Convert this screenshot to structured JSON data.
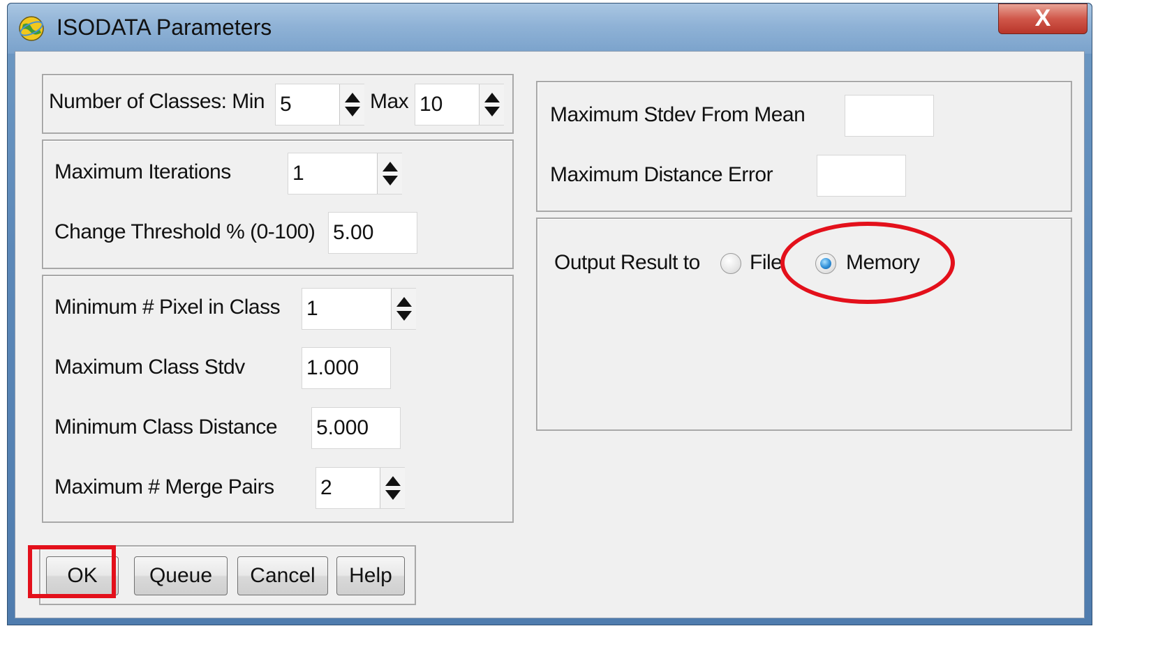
{
  "window": {
    "title": "ISODATA Parameters",
    "close_label": "X"
  },
  "classes": {
    "label": "Number of Classes: Min",
    "min_value": "5",
    "max_label": "Max",
    "max_value": "10"
  },
  "iterations": {
    "label": "Maximum Iterations",
    "value": "1"
  },
  "threshold": {
    "label": "Change Threshold % (0-100)",
    "value": "5.00"
  },
  "min_pixel": {
    "label": "Minimum # Pixel in Class",
    "value": "1"
  },
  "max_stdv": {
    "label": "Maximum Class Stdv",
    "value": "1.000"
  },
  "min_distance": {
    "label": "Minimum Class Distance",
    "value": "5.000"
  },
  "merge_pairs": {
    "label": "Maximum # Merge Pairs",
    "value": "2"
  },
  "stdev_from_mean": {
    "label": "Maximum Stdev From Mean",
    "value": ""
  },
  "distance_error": {
    "label": "Maximum Distance Error",
    "value": ""
  },
  "output": {
    "label": "Output Result to",
    "option_file": "File",
    "option_memory": "Memory",
    "selected": "Memory"
  },
  "buttons": {
    "ok": "OK",
    "queue": "Queue",
    "cancel": "Cancel",
    "help": "Help"
  },
  "annotation_color": "#e3101b"
}
